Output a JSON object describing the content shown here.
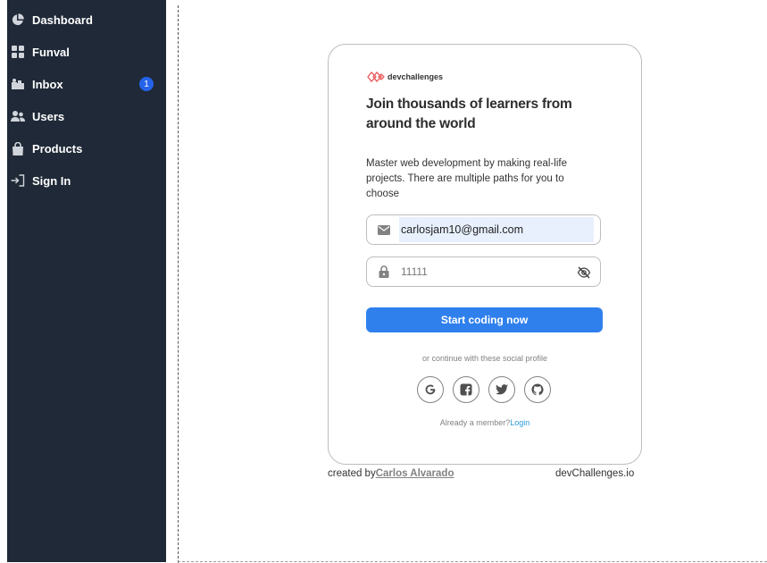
{
  "sidebar": {
    "items": [
      {
        "label": "Dashboard",
        "icon": "pie-chart-icon"
      },
      {
        "label": "Funval",
        "icon": "grid-icon"
      },
      {
        "label": "Inbox",
        "icon": "inbox-icon",
        "badge": "1"
      },
      {
        "label": "Users",
        "icon": "users-icon"
      },
      {
        "label": "Products",
        "icon": "shopping-bag-icon"
      },
      {
        "label": "Sign In",
        "icon": "sign-in-icon"
      }
    ]
  },
  "card": {
    "logo_text": "devchallenges",
    "heading": "Join thousands of learners from around the world",
    "description": "Master web development by making real-life projects. There are multiple paths for you to choose",
    "email_value": "carlosjam10@gmail.com",
    "password_placeholder": "11111",
    "submit_label": "Start coding now",
    "social_text": "or continue with these social profile",
    "socials": [
      "google-icon",
      "facebook-icon",
      "twitter-icon",
      "github-icon"
    ],
    "member_text": "Already a member?",
    "login_link": "Login"
  },
  "footer": {
    "created_by": "created by",
    "author": "Carlos Alvarado",
    "site": "devChallenges.io"
  },
  "colors": {
    "sidebar_bg": "#1f2937",
    "primary": "#2f80ed",
    "badge": "#2563eb",
    "autofill_bg": "#e8f0fe"
  }
}
